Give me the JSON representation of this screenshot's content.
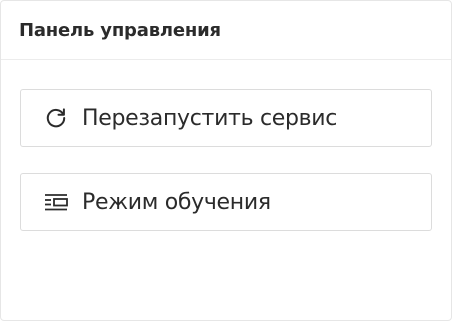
{
  "panel": {
    "title": "Панель управления"
  },
  "actions": [
    {
      "label": "Перезапустить сервис",
      "icon": "refresh-icon"
    },
    {
      "label": "Режим обучения",
      "icon": "learning-mode-icon"
    }
  ],
  "colors": {
    "text": "#2b2b2b",
    "border": "#dcdcdc",
    "background": "#ffffff"
  }
}
